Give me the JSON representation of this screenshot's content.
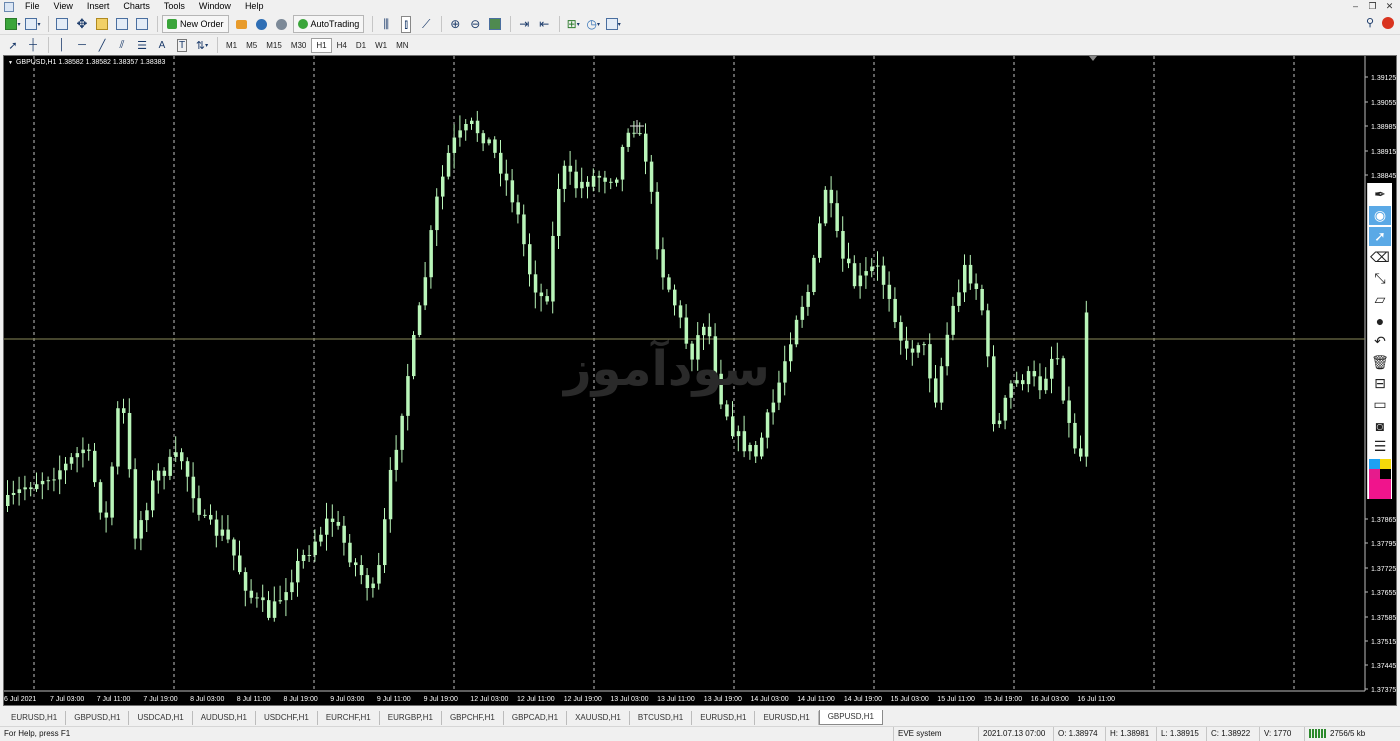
{
  "menu": [
    "File",
    "View",
    "Insert",
    "Charts",
    "Tools",
    "Window",
    "Help"
  ],
  "toolbar": {
    "new_order": "New Order",
    "auto_trading": "AutoTrading",
    "timeframes": [
      "M1",
      "M5",
      "M15",
      "M30",
      "H1",
      "H4",
      "D1",
      "W1",
      "MN"
    ],
    "active_timeframe": "H1"
  },
  "chart": {
    "info": "GBPUSD,H1  1.38582 1.38582 1.38357 1.38383",
    "watermark": "سودآموز",
    "price_labels": [
      "1.39125",
      "1.39055",
      "1.38985",
      "1.38915",
      "1.38845",
      "1.37865",
      "1.37795",
      "1.37725",
      "1.37655",
      "1.37585",
      "1.37515",
      "1.37445",
      "1.37375"
    ],
    "time_labels": [
      "6 Jul 2021",
      "7 Jul 03:00",
      "7 Jul 11:00",
      "7 Jul 19:00",
      "8 Jul 03:00",
      "8 Jul 11:00",
      "8 Jul 19:00",
      "9 Jul 03:00",
      "9 Jul 11:00",
      "9 Jul 19:00",
      "12 Jul 03:00",
      "12 Jul 11:00",
      "12 Jul 19:00",
      "13 Jul 03:00",
      "13 Jul 11:00",
      "13 Jul 19:00",
      "14 Jul 03:00",
      "14 Jul 11:00",
      "14 Jul 19:00",
      "15 Jul 03:00",
      "15 Jul 11:00",
      "15 Jul 19:00",
      "16 Jul 03:00",
      "16 Jul 11:00"
    ],
    "colors": {
      "background": "#000000",
      "candle": "#b9f5b9",
      "grid": "#bfbfbf",
      "hline": "#8a8a5a"
    }
  },
  "tabs": [
    "EURUSD,H1",
    "GBPUSD,H1",
    "USDCAD,H1",
    "AUDUSD,H1",
    "USDCHF,H1",
    "EURCHF,H1",
    "EURGBP,H1",
    "GBPCHF,H1",
    "GBPCAD,H1",
    "XAUUSD,H1",
    "BTCUSD,H1",
    "EURUSD,H1",
    "EURUSD,H1",
    "GBPUSD,H1"
  ],
  "active_tab": "GBPUSD,H1",
  "status": {
    "help": "For Help, press F1",
    "profile": "EVE system",
    "datetime": "2021.07.13 07:00",
    "open": "O: 1.38974",
    "high": "H: 1.38981",
    "low": "L: 1.38915",
    "close": "C: 1.38922",
    "volume": "V: 1770",
    "traffic": "2756/5 kb"
  },
  "side_tools": [
    "pen-icon",
    "eye-icon",
    "cursor-icon",
    "eraser-icon",
    "line-icon",
    "ruler-icon",
    "dot-icon",
    "undo-icon",
    "trash-icon",
    "delete-icon",
    "screen-icon",
    "camera-icon",
    "notes-icon"
  ]
}
